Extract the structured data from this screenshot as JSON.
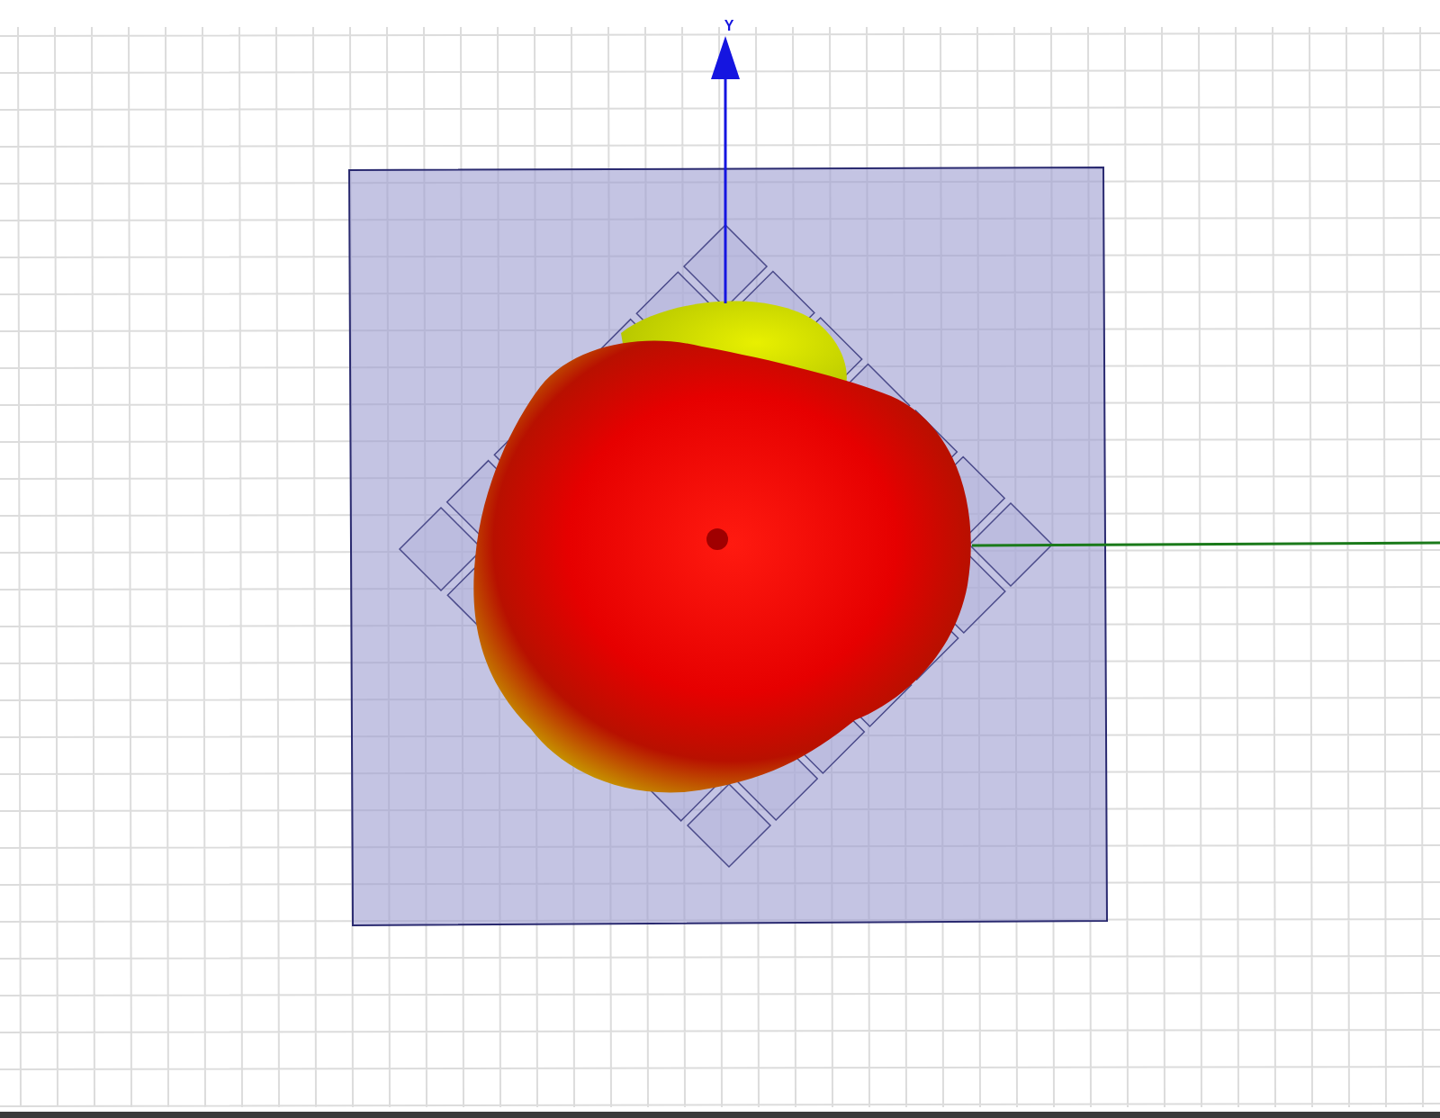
{
  "viewport": {
    "y_axis_label": "Y"
  }
}
